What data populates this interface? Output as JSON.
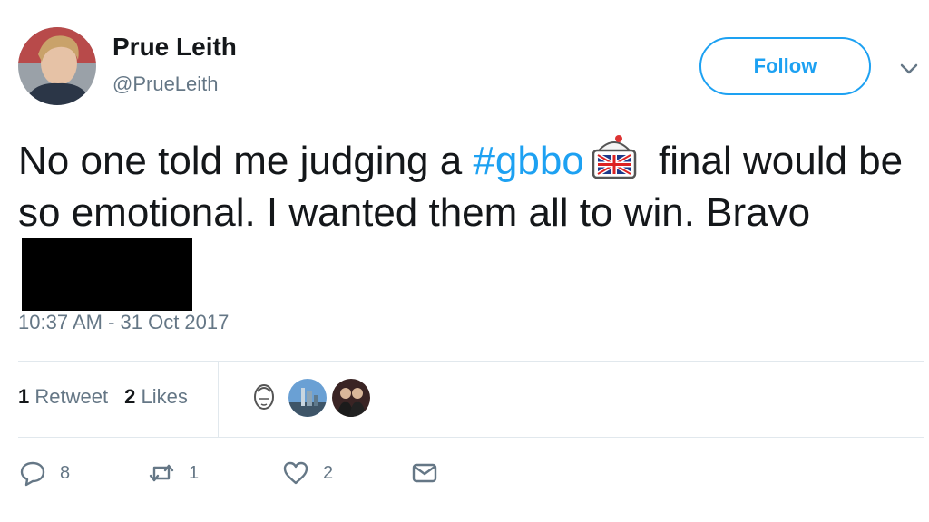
{
  "author": {
    "name": "Prue Leith",
    "handle": "@PrueLeith"
  },
  "follow_label": "Follow",
  "tweet": {
    "text_part1": "No one told me judging a ",
    "hashtag": "#gbbo",
    "text_part2": " final would be so emotional. I wanted them all to win. Bravo",
    "emoji": "gbbo-union-jack-icon"
  },
  "timestamp": "10:37 AM - 31 Oct 2017",
  "stats": {
    "retweet_count": "1",
    "retweet_label": "Retweet",
    "like_count": "2",
    "like_label": "Likes"
  },
  "actions": {
    "reply_count": "8",
    "retweet_count": "1",
    "like_count": "2"
  },
  "colors": {
    "accent": "#1da1f2",
    "muted": "#657786",
    "text": "#14171a"
  }
}
